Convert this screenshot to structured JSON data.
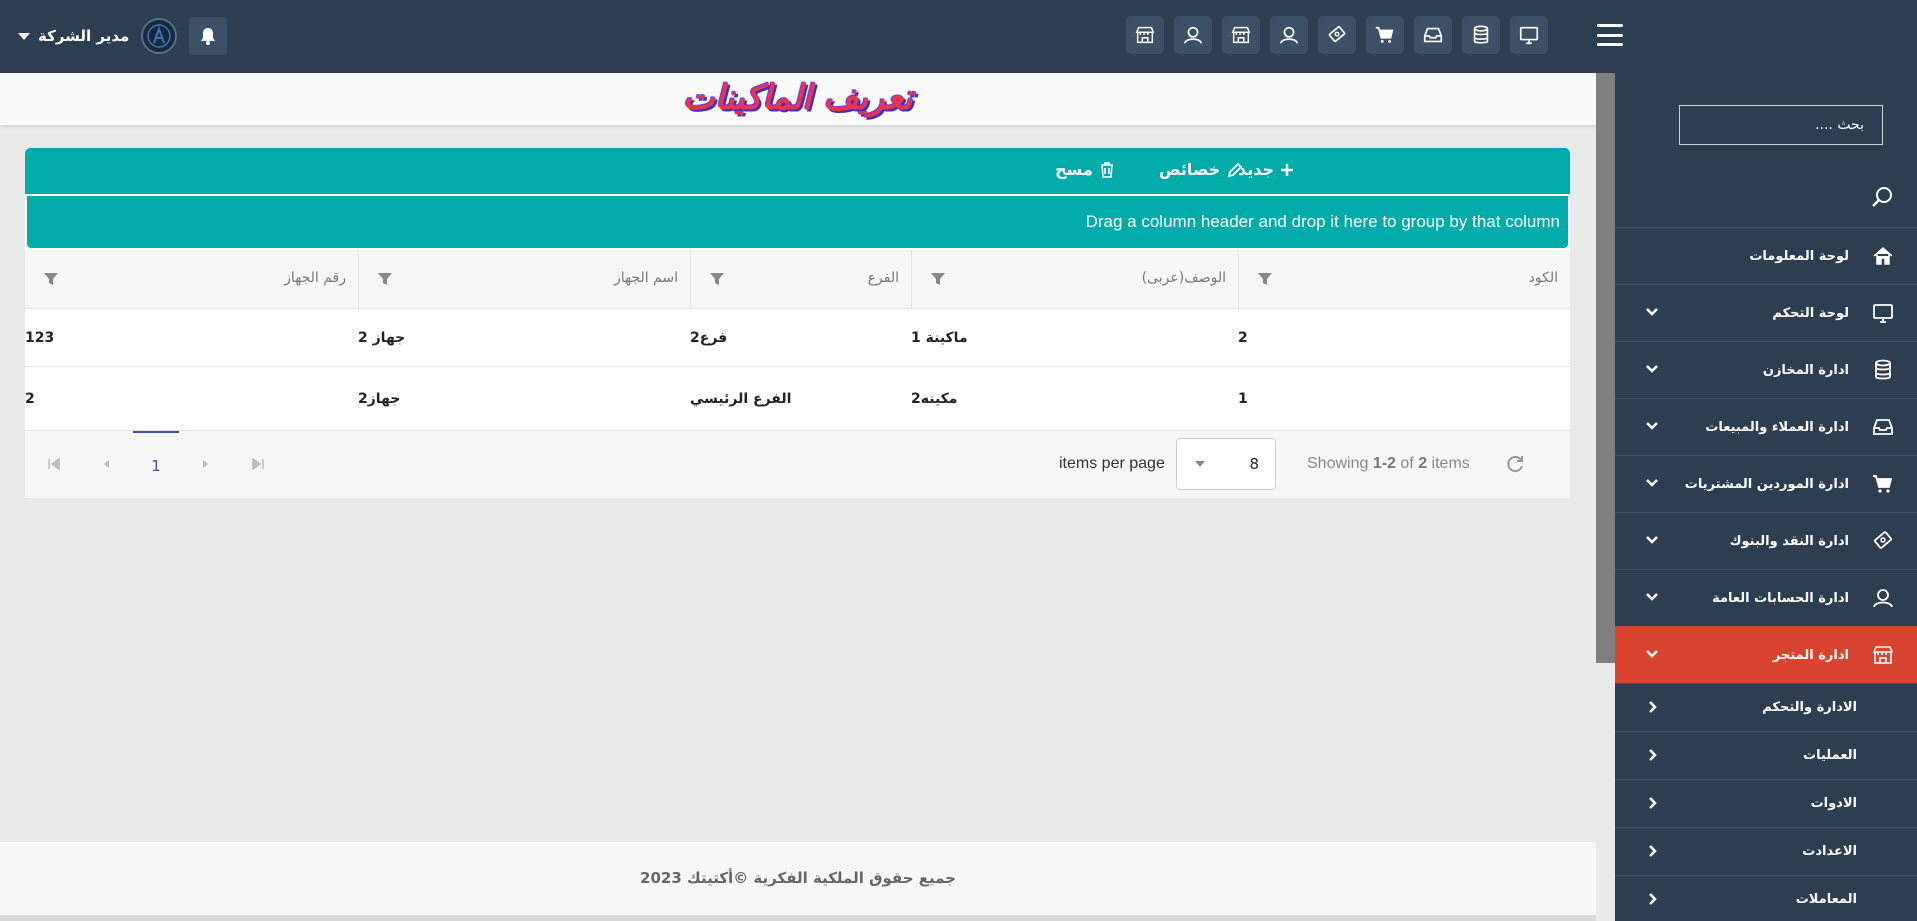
{
  "header": {
    "user_name": "مدير الشركة",
    "top_icons": [
      "store-icon",
      "user-icon",
      "store-icon",
      "user-icon",
      "money-icon",
      "cart-icon",
      "inbox-icon",
      "database-icon",
      "monitor-icon"
    ]
  },
  "page": {
    "title": "تعريف الماكينات"
  },
  "sidebar": {
    "search_placeholder": "بحث ....",
    "menu": [
      {
        "label": "لوحة المعلومات",
        "icon": "home-icon",
        "has_chevron": false
      },
      {
        "label": "لوحة التحكم",
        "icon": "monitor-icon",
        "has_chevron": true
      },
      {
        "label": "ادارة المخازن",
        "icon": "database-icon",
        "has_chevron": true
      },
      {
        "label": "ادارة العملاء والمبيعات",
        "icon": "inbox-icon",
        "has_chevron": true
      },
      {
        "label": "ادارة الموردين المشتريات",
        "icon": "cart-icon",
        "has_chevron": true
      },
      {
        "label": "ادارة النقد والبنوك",
        "icon": "money-icon",
        "has_chevron": true
      },
      {
        "label": "ادارة الحسابات العامة",
        "icon": "user-icon",
        "has_chevron": true
      },
      {
        "label": "ادارة المتجر",
        "icon": "store-icon",
        "has_chevron": true,
        "active": true
      }
    ],
    "submenu": [
      {
        "label": "الادارة والتحكم"
      },
      {
        "label": "العمليات"
      },
      {
        "label": "الادوات"
      },
      {
        "label": "الاعدادت"
      },
      {
        "label": "المعاملات"
      }
    ]
  },
  "toolbar": {
    "new_label": "جديد",
    "edit_label": "خصائص",
    "delete_label": "مسح"
  },
  "grid": {
    "group_panel_text": "Drag a column header and drop it here to group by that column",
    "columns": [
      "الكود",
      "الوصف(عربى)",
      "الفرع",
      "اسم الجهاز",
      "رقم الجهاز"
    ],
    "rows": [
      [
        "2",
        "ماكينة 1",
        "فرع2",
        "جهاز 2",
        "123"
      ],
      [
        "1",
        "مكينه2",
        "الفرع الرئيسي",
        "جهاز2",
        "2"
      ]
    ]
  },
  "pager": {
    "current_page": "1",
    "page_size": "8",
    "items_per_page_label": "items per page",
    "info_prefix": "Showing ",
    "info_range": "1-2",
    "info_mid": " of ",
    "info_total": "2",
    "info_suffix": " items"
  },
  "footer": {
    "text": "جميع حقوق الملكية الفكرية ©أكتيتك 2023"
  },
  "colors": {
    "topbar": "#2c3e50",
    "accent": "#00aca9",
    "active_menu": "#d84430",
    "pager_active": "#3f51b5"
  }
}
